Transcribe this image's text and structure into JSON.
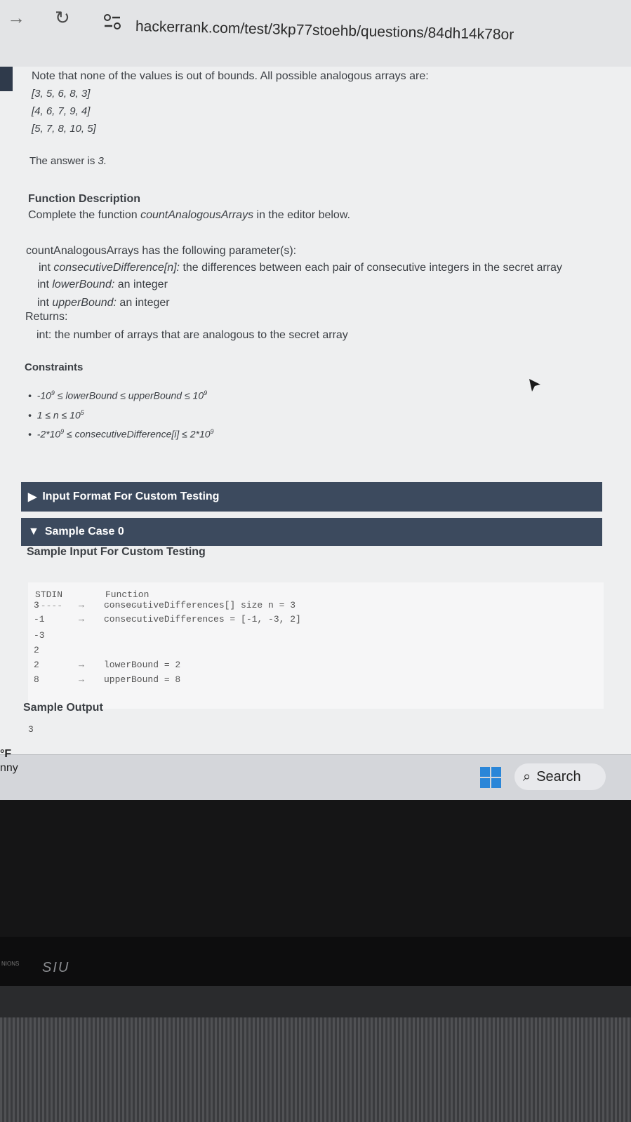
{
  "browser": {
    "url": "hackerrank.com/test/3kp77stoehb/questions/84dh14k78or"
  },
  "problem": {
    "note": "Note that none of the values is out of bounds. All possible analogous arrays are:",
    "arrays": [
      "[3, 5, 6, 8, 3]",
      "[4, 6, 7, 9, 4]",
      "[5, 7, 8, 10, 5]"
    ],
    "answer_prefix": "The answer is ",
    "answer_value": "3.",
    "function_description_heading": "Function Description",
    "complete_prefix": "Complete the function ",
    "function_name": "countAnalogousArrays",
    "complete_suffix": " in the editor below.",
    "params_intro": "countAnalogousArrays has the following parameter(s):",
    "param1_type": "int ",
    "param1_name": "consecutiveDifference[n]:",
    "param1_desc": " the differences between each pair of consecutive integers in the secret array",
    "param2_type": "int ",
    "param2_name": "lowerBound:",
    "param2_desc": " an integer",
    "param3_type": "int ",
    "param3_name": "upperBound:",
    "param3_desc": " an integer",
    "returns_label": "Returns:",
    "returns_desc": "int: the number of arrays that are analogous to the secret array",
    "constraints_heading": "Constraints",
    "constraints": [
      {
        "pre": "-10",
        "sup": "9",
        "post": " ≤ lowerBound ≤ upperBound ≤ 10",
        "sup2": "9"
      },
      {
        "pre": "1 ≤ n ≤ 10",
        "sup": "5",
        "post": "",
        "sup2": ""
      },
      {
        "pre": "-2*10",
        "sup": "9",
        "post": " ≤ consecutiveDifference[i] ≤ 2*10",
        "sup2": "9"
      }
    ],
    "input_format_label": "Input Format For Custom Testing",
    "sample_case_label": "Sample Case 0",
    "sample_input_heading": "Sample Input For Custom Testing",
    "stdin_header": "STDIN",
    "stdin_underline": "-----",
    "function_header": "Function",
    "function_underline": "--------",
    "stdin_rows": [
      {
        "value": "3",
        "arrow": "→",
        "desc": "consecutiveDifferences[] size n = 3"
      },
      {
        "value": "-1",
        "arrow": "→",
        "desc": "consecutiveDifferences = [-1, -3, 2]"
      },
      {
        "value": "-3",
        "arrow": "",
        "desc": ""
      },
      {
        "value": "2",
        "arrow": "",
        "desc": ""
      },
      {
        "value": "2",
        "arrow": "→",
        "desc": "lowerBound = 2"
      },
      {
        "value": "8",
        "arrow": "→",
        "desc": "upperBound = 8"
      }
    ],
    "sample_output_heading": "Sample Output",
    "sample_output_value": "3"
  },
  "taskbar": {
    "left_label_1": "°F",
    "left_label_2": "nny",
    "search_label": "Search"
  },
  "laptop": {
    "brand": "SIU",
    "small_text": "NIONS"
  }
}
